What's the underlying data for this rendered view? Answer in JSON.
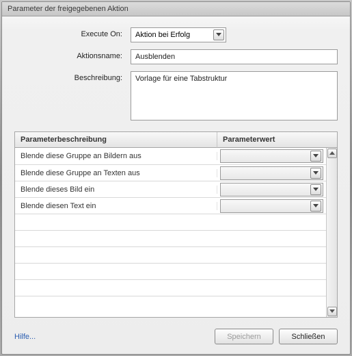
{
  "title": "Parameter der freigegebenen Aktion",
  "form": {
    "executeOn": {
      "label": "Execute On:",
      "value": "Aktion bei Erfolg"
    },
    "actionName": {
      "label": "Aktionsname:",
      "value": "Ausblenden"
    },
    "description": {
      "label": "Beschreibung:",
      "value": "Vorlage für eine Tabstruktur"
    }
  },
  "table": {
    "headers": {
      "desc": "Parameterbeschreibung",
      "value": "Parameterwert"
    },
    "rows": [
      {
        "desc": "Blende diese Gruppe an Bildern aus",
        "value": ""
      },
      {
        "desc": "Blende diese Gruppe an Texten aus",
        "value": ""
      },
      {
        "desc": "Blende dieses Bild ein",
        "value": ""
      },
      {
        "desc": "Blende diesen Text ein",
        "value": ""
      }
    ],
    "emptyRows": 6
  },
  "footer": {
    "help": "Hilfe...",
    "save": "Speichern",
    "close": "Schließen"
  }
}
